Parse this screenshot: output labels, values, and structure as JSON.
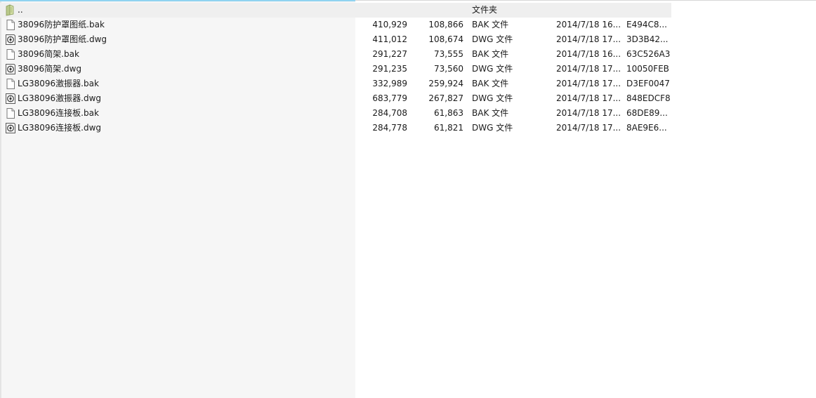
{
  "parent_row": {
    "name": "..",
    "type": "文件夹",
    "icon": "folder-up-icon"
  },
  "files": [
    {
      "name": "38096防护罩图纸.bak",
      "size": "410,929",
      "packed": "108,866",
      "type": "BAK 文件",
      "modified": "2014/7/18 16...",
      "crc": "E494C8...",
      "icon": "document-icon"
    },
    {
      "name": "38096防护罩图纸.dwg",
      "size": "411,012",
      "packed": "108,674",
      "type": "DWG 文件",
      "modified": "2014/7/18 17...",
      "crc": "3D3B42...",
      "icon": "dwg-file-icon"
    },
    {
      "name": "38096简架.bak",
      "size": "291,227",
      "packed": "73,555",
      "type": "BAK 文件",
      "modified": "2014/7/18 16...",
      "crc": "63C526A3",
      "icon": "document-icon"
    },
    {
      "name": "38096简架.dwg",
      "size": "291,235",
      "packed": "73,560",
      "type": "DWG 文件",
      "modified": "2014/7/18 17...",
      "crc": "10050FEB",
      "icon": "dwg-file-icon"
    },
    {
      "name": "LG38096激振器.bak",
      "size": "332,989",
      "packed": "259,924",
      "type": "BAK 文件",
      "modified": "2014/7/18 17...",
      "crc": "D3EF0047",
      "icon": "document-icon"
    },
    {
      "name": "LG38096激振器.dwg",
      "size": "683,779",
      "packed": "267,827",
      "type": "DWG 文件",
      "modified": "2014/7/18 17...",
      "crc": "848EDCF8",
      "icon": "dwg-file-icon"
    },
    {
      "name": "LG38096连接板.bak",
      "size": "284,708",
      "packed": "61,863",
      "type": "BAK 文件",
      "modified": "2014/7/18 17...",
      "crc": "68DE89...",
      "icon": "document-icon"
    },
    {
      "name": "LG38096连接板.dwg",
      "size": "284,778",
      "packed": "61,821",
      "type": "DWG 文件",
      "modified": "2014/7/18 17...",
      "crc": "8AE9E6...",
      "icon": "dwg-file-icon"
    }
  ],
  "colors": {
    "accent": "#8fd3f0",
    "name_column_bg": "#f6f6f6",
    "parent_row_bg": "#efefef",
    "text": "#1a1a1a"
  }
}
